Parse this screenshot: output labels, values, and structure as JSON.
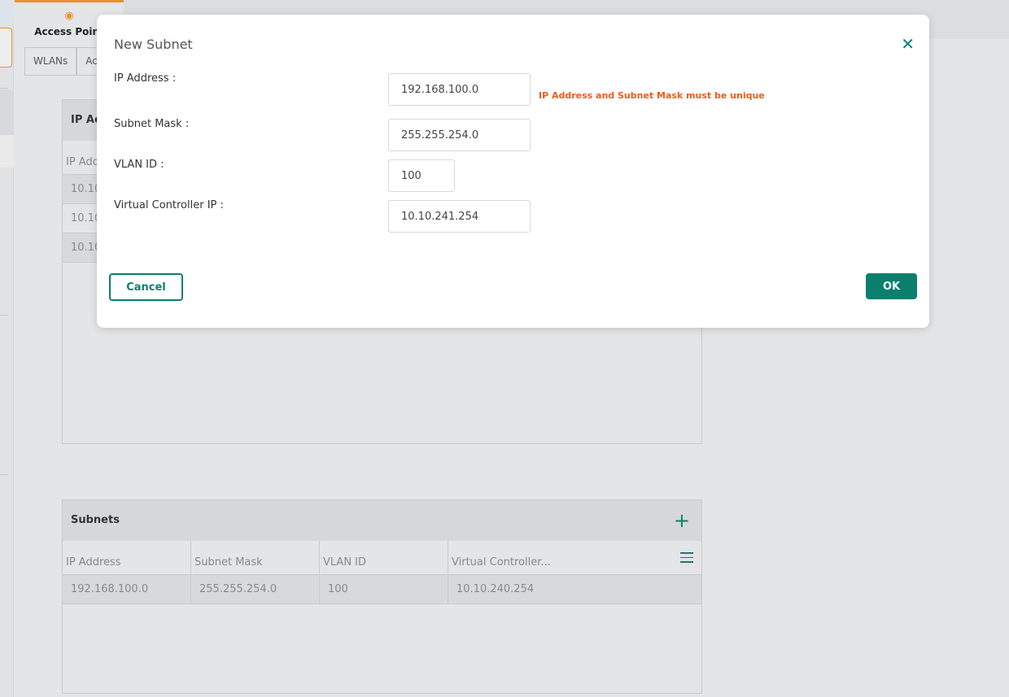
{
  "app": {
    "tab_label": "Access Point",
    "tab_icon": "access-point-icon"
  },
  "subtabs": [
    "WLANs",
    "Ac"
  ],
  "ip_panel": {
    "title": "IP Ac",
    "col_header": "IP Add",
    "rows": [
      "10.10",
      "10.10",
      "10.10"
    ]
  },
  "subnets": {
    "title": "Subnets",
    "columns": [
      "IP Address",
      "Subnet Mask",
      "VLAN ID",
      "Virtual Controller..."
    ],
    "rows": [
      [
        "192.168.100.0",
        "255.255.254.0",
        "100",
        "10.10.240.254"
      ]
    ]
  },
  "modal": {
    "title": "New Subnet",
    "fields": [
      {
        "label": "IP Address :",
        "value": "192.168.100.0"
      },
      {
        "label": "Subnet Mask :",
        "value": "255.255.254.0"
      },
      {
        "label": "VLAN ID :",
        "value": "100"
      },
      {
        "label": "Virtual Controller IP :",
        "value": "10.10.241.254"
      }
    ],
    "error": "IP Address and Subnet Mask must be unique",
    "cancel": "Cancel",
    "ok": "OK"
  },
  "colors": {
    "accent": "#0b7f6e",
    "orange": "#e8922f",
    "error": "#f05a1a"
  }
}
